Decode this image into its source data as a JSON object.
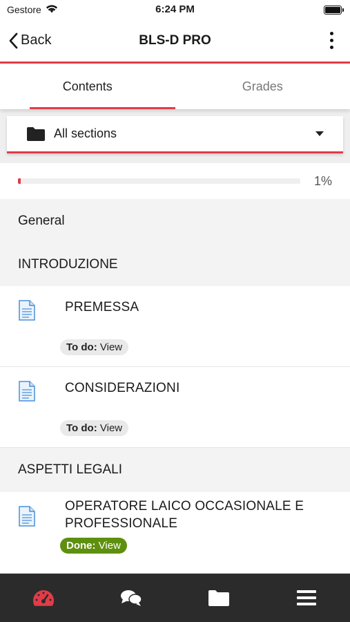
{
  "status_bar": {
    "carrier": "Gestore",
    "time": "6:24 PM"
  },
  "nav": {
    "back_label": "Back",
    "title": "BLS-D PRO"
  },
  "tabs": [
    {
      "label": "Contents",
      "active": true
    },
    {
      "label": "Grades",
      "active": false
    }
  ],
  "section_selector": {
    "label": "All sections"
  },
  "progress": {
    "percent_label": "1%",
    "value": 0.01
  },
  "sections": {
    "general": {
      "title": "General"
    },
    "introduzione": {
      "title": "INTRODUZIONE",
      "items": [
        {
          "title": "PREMESSA",
          "badge_status": "To do:",
          "badge_action": "View"
        },
        {
          "title": "CONSIDERAZIONI",
          "badge_status": "To do:",
          "badge_action": "View"
        }
      ]
    },
    "aspetti_legali": {
      "title": "ASPETTI LEGALI",
      "items": [
        {
          "title_line1": "OPERATORE LAICO OCCASIONALE E",
          "title_line2": "PROFESSIONALE",
          "badge_status": "Done:",
          "badge_action": "View"
        }
      ]
    }
  },
  "bottom_bar": [
    "dashboard-icon",
    "messages-icon",
    "folder-icon",
    "menu-icon"
  ],
  "colors": {
    "accent": "#e13c48",
    "done": "#5e8f0e",
    "page_icon": "#4a90d9"
  }
}
